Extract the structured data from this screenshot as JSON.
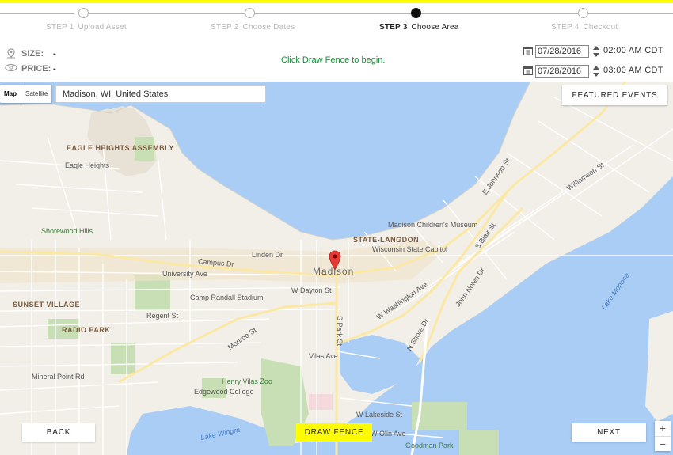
{
  "steps": [
    {
      "num": "STEP 1",
      "label": "Upload Asset"
    },
    {
      "num": "STEP 2",
      "label": "Choose Dates"
    },
    {
      "num": "STEP 3",
      "label": "Choose Area"
    },
    {
      "num": "STEP 4",
      "label": "Checkout"
    }
  ],
  "active_step": 3,
  "summary": {
    "size_label": "SIZE:",
    "size_value": "-",
    "price_label": "PRICE:",
    "price_value": "-"
  },
  "hint": "Click Draw Fence to begin.",
  "schedule": {
    "start": {
      "date": "07/28/2016",
      "time": "02:00",
      "ampm": "AM",
      "tz": "CDT"
    },
    "end": {
      "date": "07/28/2016",
      "time": "03:00",
      "ampm": "AM",
      "tz": "CDT"
    }
  },
  "map": {
    "type_map": "Map",
    "type_satellite": "Satellite",
    "search_value": "Madison, WI, United States",
    "featured_events": "FEATURED EVENTS",
    "zoom_in": "+",
    "zoom_out": "−",
    "labels": {
      "madison": "Madison",
      "eagle_heights_assembly": "EAGLE HEIGHTS ASSEMBLY",
      "eagle_heights": "Eagle Heights",
      "shorewood_hills": "Shorewood Hills",
      "state_langdon": "STATE-LANGDON",
      "childrens_museum": "Madison Children's Museum",
      "capitol": "Wisconsin State Capitol",
      "camp_randall": "Camp Randall Stadium",
      "sunset_village": "SUNSET VILLAGE",
      "radio_park": "RADIO PARK",
      "henry_vilas_zoo": "Henry Vilas Zoo",
      "edgewood_college": "Edgewood College",
      "goodman_park": "Goodman Park",
      "lake_monona": "Lake Monona",
      "lake_wingra": "Lake Wingra",
      "campus_dr": "Campus Dr",
      "regent_st": "Regent St",
      "john_nolen_dr": "John Nolen Dr",
      "w_washington_ave": "W Washington Ave",
      "university_ave": "University Ave",
      "s_park_st": "S Park St",
      "n_shore_dr": "N Shore Dr",
      "mineral_point_rd": "Mineral Point Rd",
      "monroe_st": "Monroe St",
      "linden_dr": "Linden Dr",
      "w_dayton_st": "W Dayton St",
      "vilas_ave": "Vilas Ave",
      "s_blair_st": "S Blair St",
      "williamson_st": "Williamson St",
      "e_johnson_st": "E Johnson St",
      "lakeside_st": "W Lakeside St",
      "olin_ave": "W Olin Ave"
    }
  },
  "buttons": {
    "back": "BACK",
    "draw_fence": "DRAW FENCE",
    "next": "NEXT"
  },
  "colors": {
    "brand_yellow": "#fffc00",
    "hint_green": "#1b8c3a",
    "water": "#a9cdf5",
    "land": "#f2efe9"
  }
}
